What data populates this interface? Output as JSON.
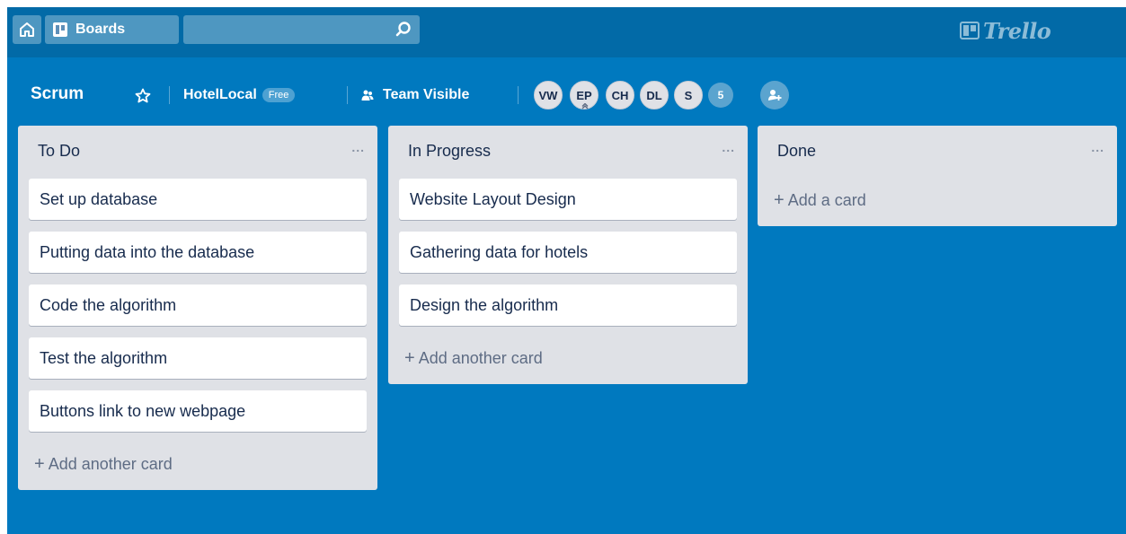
{
  "header": {
    "home_icon": "home-icon",
    "boards_label": "Boards",
    "boards_icon": "boards-icon",
    "search_placeholder": "",
    "search_icon": "search-icon",
    "logo_text": "Trello"
  },
  "board": {
    "title": "Scrum",
    "team": "HotelLocal",
    "team_badge": "Free",
    "visibility": "Team Visible",
    "members": [
      "VW",
      "EP",
      "CH",
      "DL",
      "S"
    ],
    "more_members": "5"
  },
  "lists": [
    {
      "title": "To Do",
      "menu": "...",
      "cards": [
        "Set up database",
        "Putting data into the database",
        "Code the algorithm",
        "Test the algorithm",
        "Buttons link to new webpage"
      ],
      "add_label": "Add another card"
    },
    {
      "title": "In Progress",
      "menu": "...",
      "cards": [
        "Website Layout Design",
        "Gathering data for hotels",
        "Design the algorithm"
      ],
      "add_label": "Add another card"
    },
    {
      "title": "Done",
      "menu": "...",
      "cards": [],
      "add_label": "Add a card"
    }
  ],
  "colors": {
    "board_bg": "#0079bf",
    "header_bg": "#026aa7",
    "list_bg": "#dfe1e6",
    "card_bg": "#ffffff"
  }
}
